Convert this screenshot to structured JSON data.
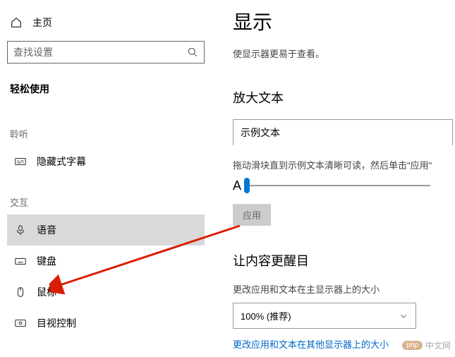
{
  "sidebar": {
    "home_label": "主页",
    "search_placeholder": "查找设置",
    "section_title": "轻松使用",
    "group_hearing": "聆听",
    "group_interaction": "交互",
    "items": {
      "captions": "隐藏式字幕",
      "speech": "语音",
      "keyboard": "键盘",
      "mouse": "鼠标",
      "eye_control": "目视控制"
    }
  },
  "main": {
    "title": "显示",
    "description": "使显示器更易于查看。",
    "enlarge_heading": "放大文本",
    "sample_text": "示例文本",
    "slider_hint": "拖动滑块直到示例文本清晰可读，然后单击\"应用\"",
    "slider_letter": "A",
    "apply_label": "应用",
    "content_heading": "让内容更醒目",
    "scale_label": "更改应用和文本在主显示器上的大小",
    "scale_value": "100% (推荐)",
    "other_displays_link": "更改应用和文本在其他显示器上的大小"
  },
  "watermark": {
    "badge": "php",
    "text": "中文网"
  }
}
